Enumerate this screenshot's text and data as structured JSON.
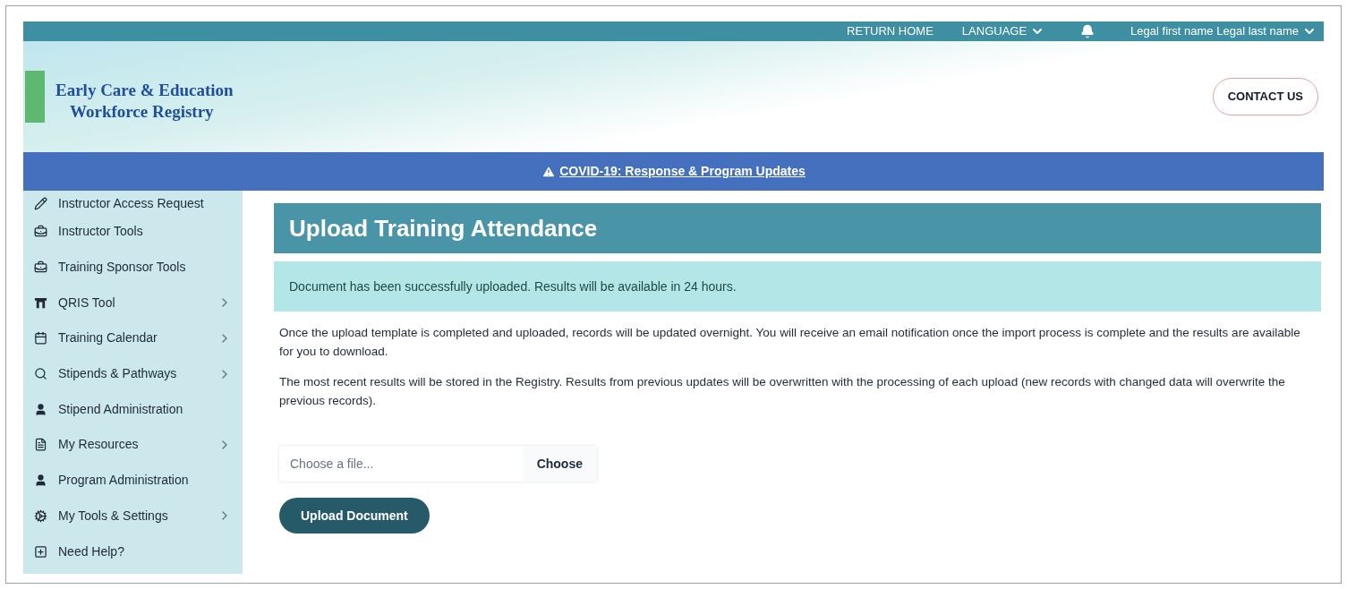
{
  "top_bar": {
    "links": [
      {
        "label": "RETURN HOME",
        "has_dropdown": false
      },
      {
        "label": "LANGUAGE",
        "has_dropdown": true
      }
    ],
    "user": {
      "label": "Legal first name Legal last name",
      "has_dropdown": true
    }
  },
  "header": {
    "logo_lines": [
      "Early Care & Education",
      "Workforce Registry"
    ],
    "contact_button": "CONTACT US"
  },
  "alert_banner": {
    "link": "COVID-19: Response & Program Updates"
  },
  "sidebar": {
    "items": [
      {
        "label": "Instructor Access Request",
        "has_submenu": false
      },
      {
        "label": "Instructor Tools",
        "has_submenu": false
      },
      {
        "label": "Training Sponsor Tools",
        "has_submenu": false
      },
      {
        "label": "QRIS Tool",
        "has_submenu": true
      },
      {
        "label": "Training Calendar",
        "has_submenu": true
      },
      {
        "label": "Stipends & Pathways",
        "has_submenu": true
      },
      {
        "label": "Stipend Administration",
        "has_submenu": false
      },
      {
        "label": "My Resources",
        "has_submenu": true
      },
      {
        "label": "Program Administration",
        "has_submenu": false
      },
      {
        "label": "My Tools & Settings",
        "has_submenu": true
      },
      {
        "label": "Need Help?",
        "has_submenu": false
      }
    ]
  },
  "main": {
    "title": "Upload Training Attendance",
    "success_message": "Document has been successfully uploaded. Results will be available in 24 hours.",
    "paragraphs": [
      "Once the upload template is completed and uploaded, records will be updated overnight. You will receive an email notification once the import process is complete and the results are available for you to download.",
      "The most recent results will be stored in the Registry. Results from previous updates will be overwritten with the processing of each upload (new records with changed data will overwrite the previous records)."
    ],
    "file_input": {
      "placeholder": "Choose a file...",
      "button": "Choose"
    },
    "upload_button": "Upload Document"
  }
}
